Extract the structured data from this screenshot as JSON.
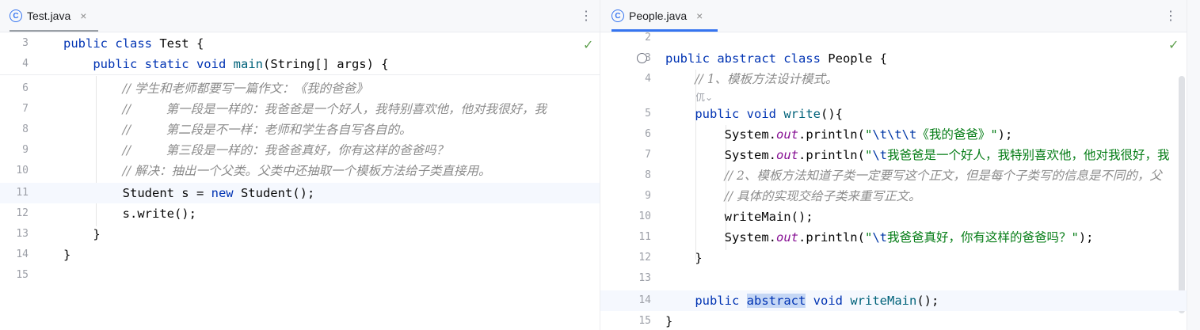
{
  "left": {
    "tab": {
      "label": "Test.java",
      "icon": "class-icon",
      "close": "×"
    },
    "menu_glyph": "⋮",
    "check_glyph": "✓",
    "lines": [
      {
        "num": "3",
        "html": "<span class=\"kw\">public class</span> Test {"
      },
      {
        "num": "4",
        "html": "    <span class=\"kw\">public static void</span> <span class=\"fn\">main</span>(String[] args) {"
      },
      {
        "num": "6",
        "html": "        <span class=\"cm\">// 学生和老师都要写一篇作文：《我的爸爸》</span>"
      },
      {
        "num": "7",
        "html": "        <span class=\"cm\">//         第一段是一样的：我爸爸是一个好人，我特别喜欢他，他对我很好，我</span>"
      },
      {
        "num": "8",
        "html": "        <span class=\"cm\">//         第二段是不一样：老师和学生各自写各自的。</span>"
      },
      {
        "num": "9",
        "html": "        <span class=\"cm\">//         第三段是一样的：我爸爸真好，你有这样的爸爸吗？</span>"
      },
      {
        "num": "10",
        "html": "        <span class=\"cm\">// 解决：抽出一个父类。父类中还抽取一个模板方法给子类直接用。</span>"
      },
      {
        "num": "11",
        "html": "        Student s = <span class=\"kw\">new</span> Student();"
      },
      {
        "num": "12",
        "html": "        s.write();"
      },
      {
        "num": "13",
        "html": "    }"
      },
      {
        "num": "14",
        "html": "}"
      },
      {
        "num": "15",
        "html": ""
      }
    ]
  },
  "right": {
    "tab": {
      "label": "People.java",
      "icon": "class-icon",
      "close": "×"
    },
    "menu_glyph": "⋮",
    "check_glyph": "✓",
    "hint_glyph": "㐳⌄",
    "lines": [
      {
        "num": "2",
        "html": ""
      },
      {
        "num": "3",
        "html": "<span class=\"kw\">public abstract class</span> People {"
      },
      {
        "num": "4",
        "html": "    <span class=\"cm\">// 1、模板方法设计模式。</span>"
      },
      {
        "num": "5",
        "html": "    <span class=\"kw\">public void</span> <span class=\"fn\">write</span>(){"
      },
      {
        "num": "6",
        "html": "        System.<span class=\"fld\">out</span>.println(<span class=\"str\">\"<span class=\"esc\">\\t\\t\\t</span>《我的爸爸》\"</span>);"
      },
      {
        "num": "7",
        "html": "        System.<span class=\"fld\">out</span>.println(<span class=\"str\">\"<span class=\"esc\">\\t</span>我爸爸是一个好人，我特别喜欢他，他对我很好，我</span>"
      },
      {
        "num": "8",
        "html": "        <span class=\"cm\">// 2、模板方法知道子类一定要写这个正文，但是每个子类写的信息是不同的，父</span>"
      },
      {
        "num": "9",
        "html": "        <span class=\"cm\">// 具体的实现交给子类来重写正文。</span>"
      },
      {
        "num": "10",
        "html": "        writeMain();"
      },
      {
        "num": "11",
        "html": "        System.<span class=\"fld\">out</span>.println(<span class=\"str\">\"<span class=\"esc\">\\t</span>我爸爸真好，你有这样的爸爸吗？\"</span>);"
      },
      {
        "num": "12",
        "html": "    }"
      },
      {
        "num": "13",
        "html": ""
      },
      {
        "num": "14",
        "html": "    <span class=\"kw\">public</span> <span class=\"kw hl\">abstract</span> <span class=\"kw\">void</span> <span class=\"fn\">writeMain</span>();"
      },
      {
        "num": "15",
        "html": "}"
      }
    ]
  }
}
